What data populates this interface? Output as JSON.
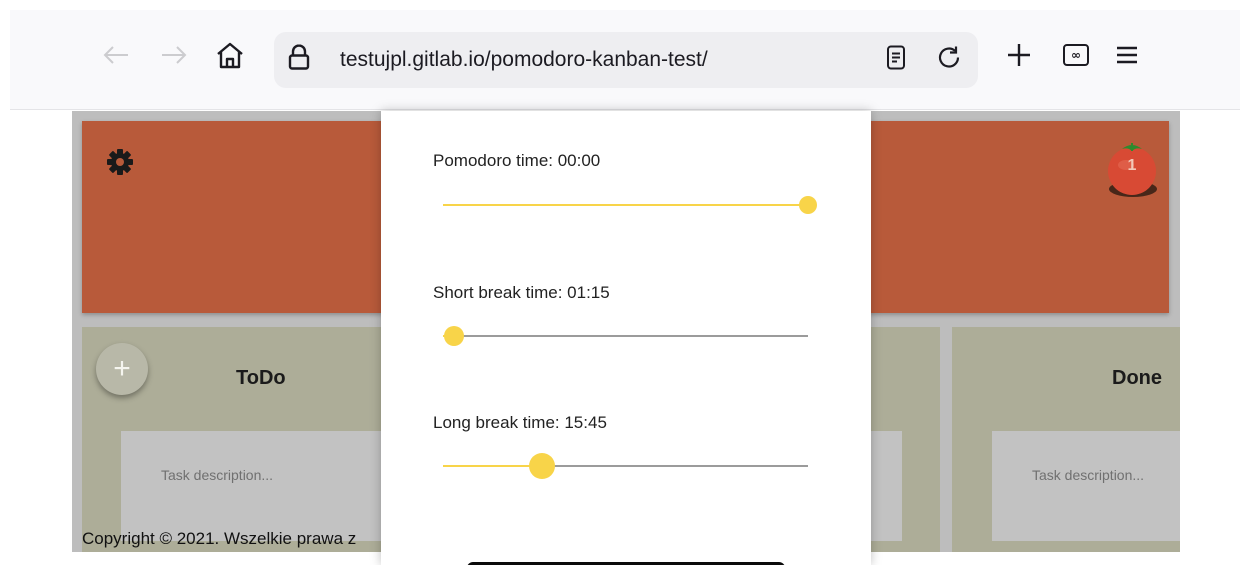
{
  "browser": {
    "url": "testujpl.gitlab.io/pomodoro-kanban-test/",
    "icons": [
      "back-arrow-icon",
      "forward-arrow-icon",
      "home-icon",
      "lock-icon",
      "reader-view-icon",
      "reload-icon",
      "new-tab-icon",
      "tab-counter-icon",
      "menu-icon"
    ]
  },
  "app": {
    "header_color": "#b85a3a",
    "tomato_count": "1",
    "columns": [
      {
        "title": "ToDo"
      },
      {
        "title": "Done"
      }
    ],
    "add_button_symbol": "+",
    "task_placeholders": [
      "Task description...",
      "Task description..."
    ],
    "copyright": "Copyright © 2021. Wszelkie prawa z"
  },
  "settings_modal": {
    "accent_color": "#f8d449",
    "sliders": [
      {
        "label": "Pomodoro time: 00:00",
        "value_fraction": 1.0
      },
      {
        "label": "Short break time: 01:15",
        "value_fraction": 0.03
      },
      {
        "label": "Long break time: 15:45",
        "value_fraction": 0.27
      }
    ]
  }
}
